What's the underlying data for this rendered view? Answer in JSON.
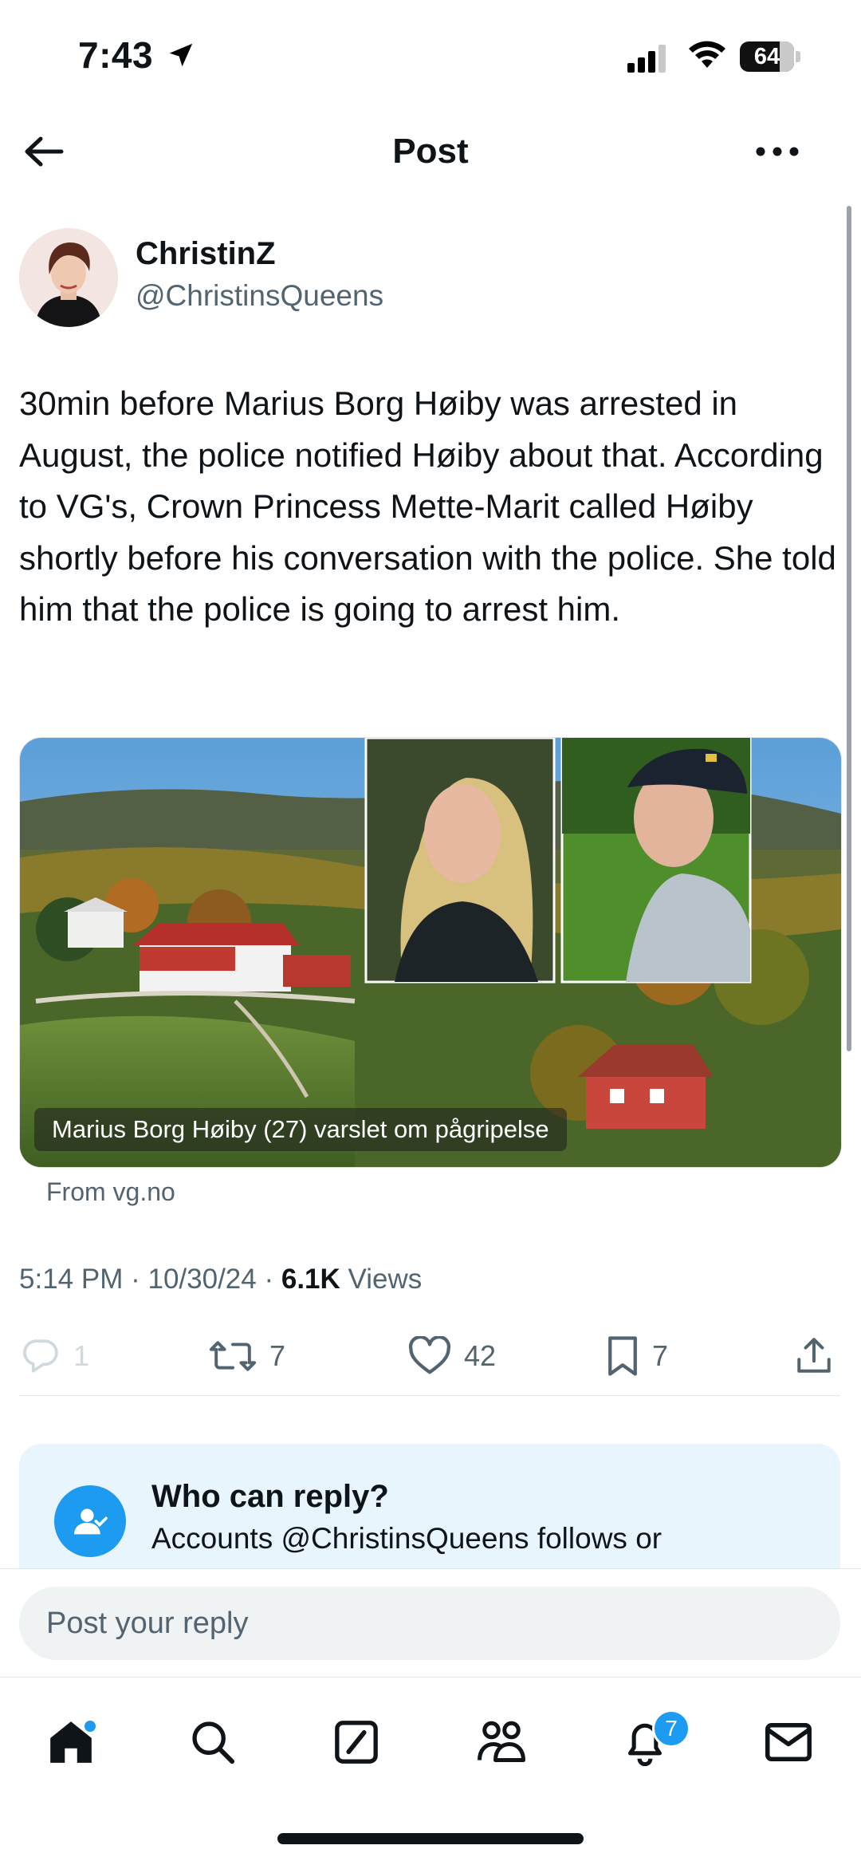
{
  "status_bar": {
    "time": "7:43",
    "battery": "64",
    "icons": [
      "location-arrow-icon",
      "cellular-signal-icon",
      "wifi-icon",
      "battery-icon"
    ]
  },
  "header": {
    "title": "Post",
    "back_icon": "arrow-left-icon",
    "more_icon": "more-horizontal-icon"
  },
  "post": {
    "author_name": "ChristinZ",
    "author_handle": "@ChristinsQueens",
    "text": "30min before Marius Borg Høiby was arrested in August, the police notified Høiby about that. According to VG's, Crown Princess Mette-Marit called Høiby shortly before his conversation with the police. She told him that the police is going to arrest him.",
    "media_caption": "Marius Borg Høiby (27) varslet om pågripelse",
    "media_source": "From vg.no",
    "time": "5:14 PM",
    "date": "10/30/24",
    "views_count": "6.1K",
    "views_label": "Views",
    "sep": "·"
  },
  "actions": {
    "replies": "1",
    "reposts": "7",
    "likes": "42",
    "bookmarks": "7"
  },
  "reply_info": {
    "title": "Who can reply?",
    "description": "Accounts @ChristinsQueens follows or"
  },
  "reply_bar": {
    "placeholder": "Post your reply"
  },
  "tab_bar": {
    "tabs": [
      "home-icon",
      "search-icon",
      "grok-icon",
      "communities-icon",
      "notifications-icon",
      "messages-icon"
    ],
    "notifications_badge": "7"
  },
  "colors": {
    "accent": "#1d9bf0",
    "text": "#0f1419",
    "secondary_text": "#536471",
    "card_bg": "#e8f5fd"
  }
}
